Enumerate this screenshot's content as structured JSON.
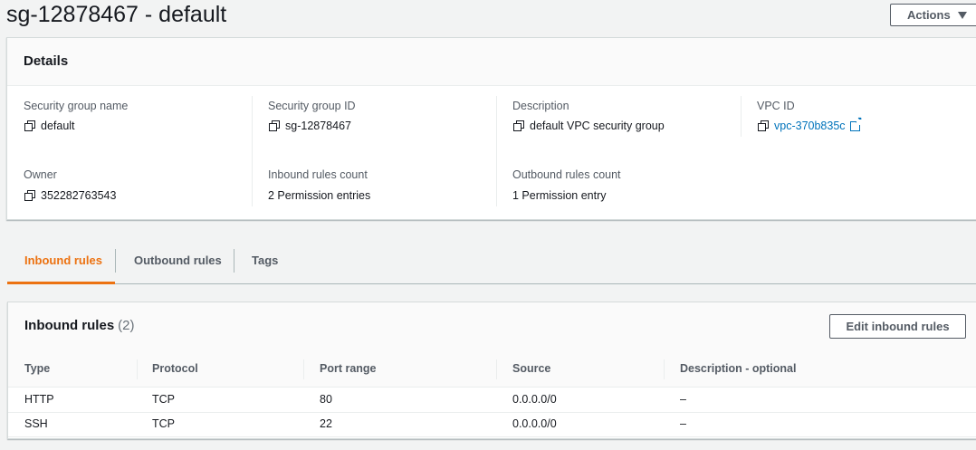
{
  "page": {
    "title": "sg-12878467 - default",
    "actions_label": "Actions"
  },
  "details": {
    "heading": "Details",
    "fields": [
      {
        "label": "Security group name",
        "value": "default"
      },
      {
        "label": "Security group ID",
        "value": "sg-12878467"
      },
      {
        "label": "Description",
        "value": "default VPC security group"
      },
      {
        "label": "VPC ID",
        "value": "vpc-370b835c"
      },
      {
        "label": "Owner",
        "value": "352282763543"
      },
      {
        "label": "Inbound rules count",
        "value": "2 Permission entries"
      },
      {
        "label": "Outbound rules count",
        "value": "1 Permission entry"
      }
    ]
  },
  "tabs": [
    {
      "label": "Inbound rules",
      "active": true
    },
    {
      "label": "Outbound rules",
      "active": false
    },
    {
      "label": "Tags",
      "active": false
    }
  ],
  "inbound": {
    "title": "Inbound rules",
    "count": "(2)",
    "edit_label": "Edit inbound rules",
    "columns": [
      "Type",
      "Protocol",
      "Port range",
      "Source",
      "Description - optional"
    ],
    "rows": [
      [
        "HTTP",
        "TCP",
        "80",
        "0.0.0.0/0",
        "–"
      ],
      [
        "SSH",
        "TCP",
        "22",
        "0.0.0.0/0",
        "–"
      ]
    ]
  },
  "icons": {
    "copy": "copy-icon",
    "external_link": "external-link-icon",
    "caret": "caret-down-icon"
  },
  "colors": {
    "accent": "#ec7211",
    "link": "#0073bb",
    "text": "#16191f",
    "muted": "#545b64",
    "background": "#f2f3f3"
  }
}
